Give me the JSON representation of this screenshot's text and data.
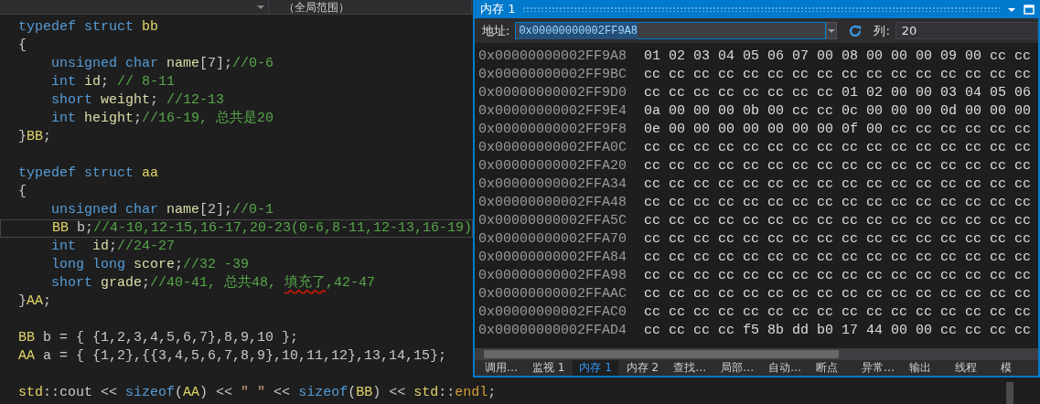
{
  "editor": {
    "context_dropdown": {
      "value": "（全局范围）"
    },
    "lines": [
      {
        "kind": "code",
        "tokens": [
          {
            "kind": "keyword",
            "text": "typedef struct "
          },
          {
            "kind": "type",
            "text": "bb"
          }
        ]
      },
      {
        "kind": "code",
        "tokens": [
          {
            "kind": "plain",
            "text": "{"
          }
        ]
      },
      {
        "kind": "code",
        "tokens": [
          {
            "kind": "keyword",
            "text": "    unsigned char "
          },
          {
            "kind": "member",
            "text": "name"
          },
          {
            "kind": "plain",
            "text": "[7];"
          },
          {
            "kind": "comment",
            "text": "//0-6"
          }
        ]
      },
      {
        "kind": "code",
        "tokens": [
          {
            "kind": "keyword",
            "text": "    int "
          },
          {
            "kind": "member",
            "text": "id"
          },
          {
            "kind": "plain",
            "text": "; "
          },
          {
            "kind": "comment",
            "text": "// 8-11"
          }
        ]
      },
      {
        "kind": "code",
        "tokens": [
          {
            "kind": "keyword",
            "text": "    short "
          },
          {
            "kind": "member",
            "text": "weight"
          },
          {
            "kind": "plain",
            "text": "; "
          },
          {
            "kind": "comment",
            "text": "//12-13"
          }
        ]
      },
      {
        "kind": "code",
        "tokens": [
          {
            "kind": "keyword",
            "text": "    int "
          },
          {
            "kind": "member",
            "text": "height"
          },
          {
            "kind": "plain",
            "text": ";"
          },
          {
            "kind": "comment",
            "text": "//16-19, 总共是20"
          }
        ]
      },
      {
        "kind": "code",
        "tokens": [
          {
            "kind": "plain",
            "text": "}"
          },
          {
            "kind": "type",
            "text": "BB"
          },
          {
            "kind": "plain",
            "text": ";"
          }
        ]
      },
      {
        "kind": "blank"
      },
      {
        "kind": "code",
        "tokens": [
          {
            "kind": "keyword",
            "text": "typedef struct "
          },
          {
            "kind": "type",
            "text": "aa"
          }
        ]
      },
      {
        "kind": "code",
        "tokens": [
          {
            "kind": "plain",
            "text": "{"
          }
        ]
      },
      {
        "kind": "code",
        "tokens": [
          {
            "kind": "keyword",
            "text": "    unsigned char "
          },
          {
            "kind": "member",
            "text": "name"
          },
          {
            "kind": "plain",
            "text": "[2];"
          },
          {
            "kind": "comment",
            "text": "//0-1"
          }
        ]
      },
      {
        "kind": "current",
        "tokens": [
          {
            "kind": "type",
            "text": "    BB"
          },
          {
            "kind": "plain",
            "text": " b;"
          },
          {
            "kind": "comment",
            "text": "//4-10,12-15,16-17,20-23(0-6,8-11,12-13,16-19)"
          }
        ]
      },
      {
        "kind": "code",
        "tokens": [
          {
            "kind": "keyword",
            "text": "    int  "
          },
          {
            "kind": "member",
            "text": "id"
          },
          {
            "kind": "plain",
            "text": ";"
          },
          {
            "kind": "comment",
            "text": "//24-27"
          }
        ]
      },
      {
        "kind": "code",
        "tokens": [
          {
            "kind": "keyword",
            "text": "    long long "
          },
          {
            "kind": "member",
            "text": "score"
          },
          {
            "kind": "plain",
            "text": ";"
          },
          {
            "kind": "comment",
            "text": "//32 -39"
          }
        ]
      },
      {
        "kind": "code",
        "tokens": [
          {
            "kind": "keyword",
            "text": "    short "
          },
          {
            "kind": "member",
            "text": "grade"
          },
          {
            "kind": "plain",
            "text": ";"
          },
          {
            "kind": "comment",
            "text": "//40-41, 总共48, "
          },
          {
            "kind": "comment",
            "text": "填充了",
            "squiggle": true
          },
          {
            "kind": "comment",
            "text": ",42-47"
          }
        ]
      },
      {
        "kind": "code",
        "tokens": [
          {
            "kind": "plain",
            "text": "}"
          },
          {
            "kind": "type",
            "text": "AA"
          },
          {
            "kind": "plain",
            "text": ";"
          }
        ]
      },
      {
        "kind": "blank"
      },
      {
        "kind": "code",
        "tokens": [
          {
            "kind": "type",
            "text": "BB"
          },
          {
            "kind": "plain",
            "text": " b = { {1,2,3,4,5,6,7},8,9,10 };"
          }
        ]
      },
      {
        "kind": "code",
        "tokens": [
          {
            "kind": "type",
            "text": "AA"
          },
          {
            "kind": "plain",
            "text": " a = { {1,2},{{3,4,5,6,7,8,9},10,11,12},13,14,15};"
          }
        ]
      },
      {
        "kind": "blank"
      },
      {
        "kind": "code",
        "tokens": [
          {
            "kind": "type",
            "text": "std"
          },
          {
            "kind": "plain",
            "text": "::cout << "
          },
          {
            "kind": "keyword",
            "text": "sizeof"
          },
          {
            "kind": "plain",
            "text": "("
          },
          {
            "kind": "type",
            "text": "AA"
          },
          {
            "kind": "plain",
            "text": ") << "
          },
          {
            "kind": "string",
            "text": "\" \""
          },
          {
            "kind": "plain",
            "text": " << "
          },
          {
            "kind": "keyword",
            "text": "sizeof"
          },
          {
            "kind": "plain",
            "text": "("
          },
          {
            "kind": "type",
            "text": "BB"
          },
          {
            "kind": "plain",
            "text": ") << "
          },
          {
            "kind": "type",
            "text": "std"
          },
          {
            "kind": "plain",
            "text": "::"
          },
          {
            "kind": "function",
            "text": "endl"
          },
          {
            "kind": "plain",
            "text": ";"
          }
        ]
      }
    ]
  },
  "memory_window": {
    "title": "内存 1",
    "address_label": "地址:",
    "address": "0x00000000002FF9A8",
    "columns_label": "列:",
    "columns": "20",
    "rows": [
      {
        "address": "0x00000000002FF9A8",
        "bytes": "01 02 03 04 05 06 07 00 08 00 00 00 09 00 cc cc"
      },
      {
        "address": "0x00000000002FF9BC",
        "bytes": "cc cc cc cc cc cc cc cc cc cc cc cc cc cc cc cc"
      },
      {
        "address": "0x00000000002FF9D0",
        "bytes": "cc cc cc cc cc cc cc cc 01 02 00 00 03 04 05 06"
      },
      {
        "address": "0x00000000002FF9E4",
        "bytes": "0a 00 00 00 0b 00 cc cc 0c 00 00 00 0d 00 00 00"
      },
      {
        "address": "0x00000000002FF9F8",
        "bytes": "0e 00 00 00 00 00 00 00 0f 00 cc cc cc cc cc cc"
      },
      {
        "address": "0x00000000002FFA0C",
        "bytes": "cc cc cc cc cc cc cc cc cc cc cc cc cc cc cc cc"
      },
      {
        "address": "0x00000000002FFA20",
        "bytes": "cc cc cc cc cc cc cc cc cc cc cc cc cc cc cc cc"
      },
      {
        "address": "0x00000000002FFA34",
        "bytes": "cc cc cc cc cc cc cc cc cc cc cc cc cc cc cc cc"
      },
      {
        "address": "0x00000000002FFA48",
        "bytes": "cc cc cc cc cc cc cc cc cc cc cc cc cc cc cc cc"
      },
      {
        "address": "0x00000000002FFA5C",
        "bytes": "cc cc cc cc cc cc cc cc cc cc cc cc cc cc cc cc"
      },
      {
        "address": "0x00000000002FFA70",
        "bytes": "cc cc cc cc cc cc cc cc cc cc cc cc cc cc cc cc"
      },
      {
        "address": "0x00000000002FFA84",
        "bytes": "cc cc cc cc cc cc cc cc cc cc cc cc cc cc cc cc"
      },
      {
        "address": "0x00000000002FFA98",
        "bytes": "cc cc cc cc cc cc cc cc cc cc cc cc cc cc cc cc"
      },
      {
        "address": "0x00000000002FFAAC",
        "bytes": "cc cc cc cc cc cc cc cc cc cc cc cc cc cc cc cc"
      },
      {
        "address": "0x00000000002FFAC0",
        "bytes": "cc cc cc cc cc cc cc cc cc cc cc cc cc cc cc cc"
      },
      {
        "address": "0x00000000002FFAD4",
        "bytes": "cc cc cc cc f5 8b dd b0 17 44 00 00 cc cc cc cc"
      }
    ],
    "tabs": [
      {
        "label": "调用…",
        "selected": false
      },
      {
        "label": "监视 1",
        "selected": false
      },
      {
        "label": "内存 1",
        "selected": true
      },
      {
        "label": "内存 2",
        "selected": false
      },
      {
        "label": "查找…",
        "selected": false
      },
      {
        "label": "局部…",
        "selected": false
      },
      {
        "label": "自动…",
        "selected": false
      },
      {
        "label": "断点",
        "selected": false
      },
      {
        "label": "异常…",
        "selected": false
      },
      {
        "label": "输出",
        "selected": false
      },
      {
        "label": "线程",
        "selected": false
      },
      {
        "label": "模",
        "selected": false
      }
    ]
  }
}
